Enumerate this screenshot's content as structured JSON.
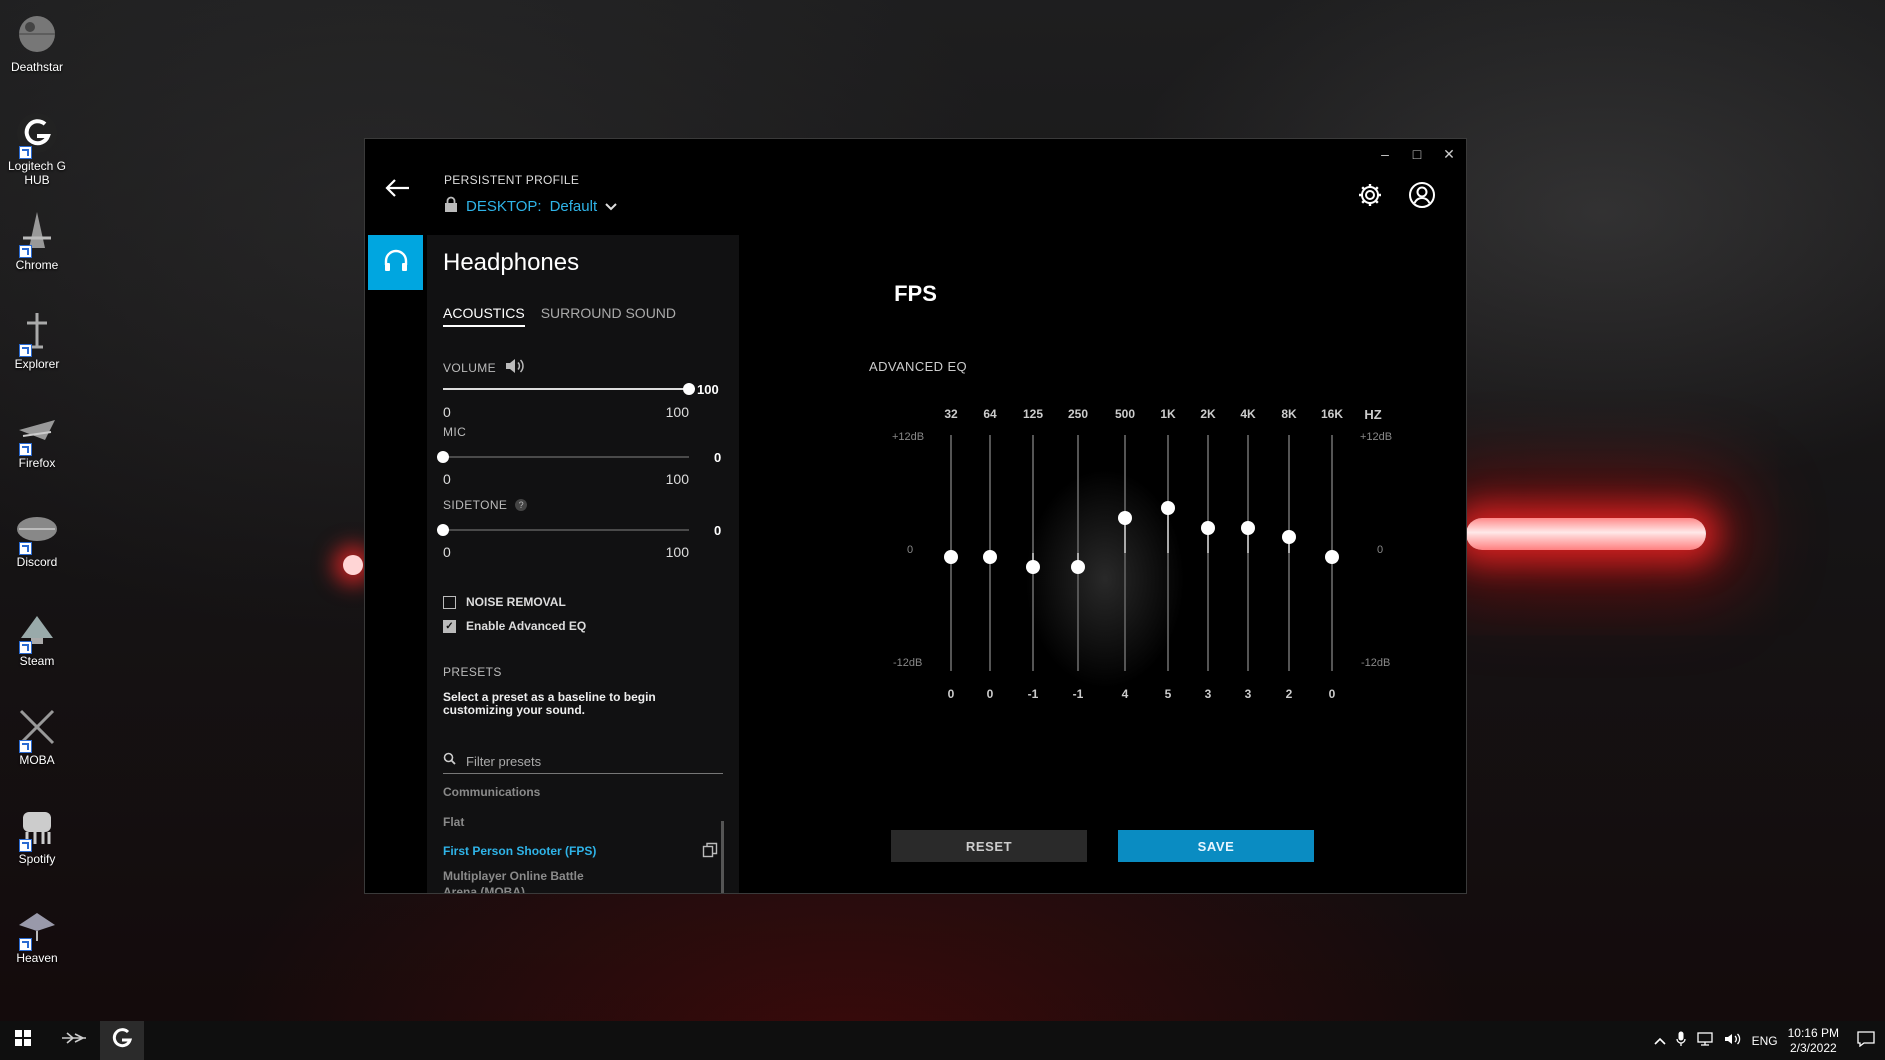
{
  "desktop": {
    "icons": [
      {
        "label": "Deathstar",
        "icon": "deathstar-icon"
      },
      {
        "label": "Logitech G HUB",
        "icon": "logitech-g-icon"
      },
      {
        "label": "Chrome",
        "icon": "chrome-icon"
      },
      {
        "label": "Explorer",
        "icon": "explorer-icon"
      },
      {
        "label": "Firefox",
        "icon": "firefox-icon"
      },
      {
        "label": "Discord",
        "icon": "discord-icon"
      },
      {
        "label": "Steam",
        "icon": "steam-icon"
      },
      {
        "label": "MOBA",
        "icon": "moba-icon"
      },
      {
        "label": "Spotify",
        "icon": "spotify-icon"
      },
      {
        "label": "Heaven",
        "icon": "heaven-icon"
      }
    ]
  },
  "window": {
    "controls": {
      "minimize": "–",
      "maximize": "□",
      "close": "✕"
    }
  },
  "profile": {
    "caption": "PERSISTENT PROFILE",
    "prefix": "DESKTOP:",
    "name": "Default"
  },
  "device": {
    "title": "Headphones",
    "tabs": [
      "ACOUSTICS",
      "SURROUND SOUND"
    ],
    "active_tab": "ACOUSTICS"
  },
  "controls": {
    "volume": {
      "label": "VOLUME",
      "value": "100",
      "level": 100,
      "min": "0",
      "max": "100"
    },
    "mic": {
      "label": "MIC",
      "value": "0",
      "level": 0,
      "min": "0",
      "max": "100"
    },
    "sidetone": {
      "label": "SIDETONE",
      "help": "?",
      "value": "0",
      "level": 0,
      "min": "0",
      "max": "100"
    },
    "noise_removal": {
      "label": "NOISE REMOVAL",
      "checked": false
    },
    "advanced_eq": {
      "label": "Enable Advanced EQ",
      "checked": true
    }
  },
  "presets": {
    "label": "PRESETS",
    "hint": "Select a preset as a baseline to begin customizing your sound.",
    "search_placeholder": "Filter presets",
    "items": [
      "Communications",
      "Flat",
      "First Person Shooter (FPS)",
      "Multiplayer Online Battle Arena (MOBA)"
    ],
    "active": "First Person Shooter (FPS)"
  },
  "eq": {
    "title": "FPS",
    "caption": "ADVANCED EQ",
    "unit": "HZ",
    "db_top": "+12dB",
    "db_mid": "0",
    "db_bottom": "-12dB",
    "range": [
      -12,
      12
    ],
    "bands": [
      {
        "freq": "32",
        "value": 0
      },
      {
        "freq": "64",
        "value": 0
      },
      {
        "freq": "125",
        "value": -1
      },
      {
        "freq": "250",
        "value": -1
      },
      {
        "freq": "500",
        "value": 4
      },
      {
        "freq": "1K",
        "value": 5
      },
      {
        "freq": "2K",
        "value": 3
      },
      {
        "freq": "4K",
        "value": 3
      },
      {
        "freq": "8K",
        "value": 2
      },
      {
        "freq": "16K",
        "value": 0
      }
    ],
    "reset_label": "RESET",
    "save_label": "SAVE"
  },
  "taskbar": {
    "language": "ENG",
    "time": "10:16 PM",
    "date": "2/3/2022"
  }
}
